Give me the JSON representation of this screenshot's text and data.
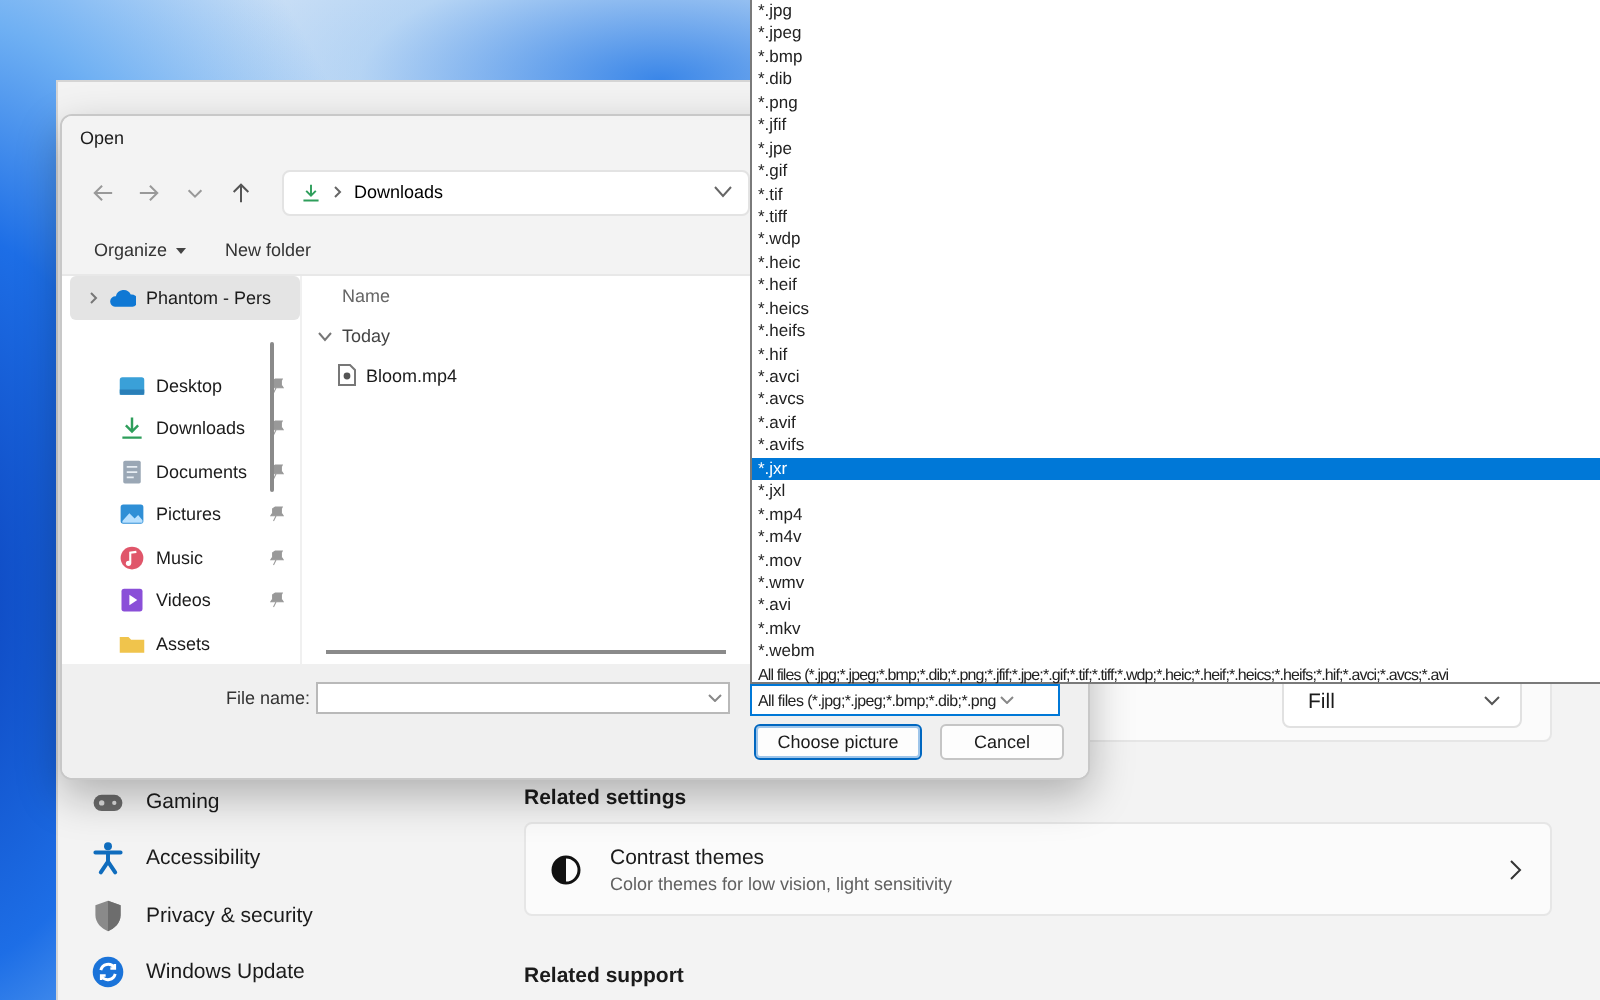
{
  "settings_window": {
    "sidebar_items": [
      {
        "label": "Gaming",
        "kind": "gaming"
      },
      {
        "label": "Accessibility",
        "kind": "accessibility"
      },
      {
        "label": "Privacy & security",
        "kind": "privacy"
      },
      {
        "label": "Windows Update",
        "kind": "update"
      }
    ],
    "fit_dropdown": {
      "value": "Fill"
    },
    "related_settings_heading": "Related settings",
    "contrast_card": {
      "title": "Contrast themes",
      "subtitle": "Color themes for low vision, light sensitivity"
    },
    "related_support_heading": "Related support"
  },
  "dialog": {
    "title": "Open",
    "address": {
      "location": "Downloads"
    },
    "toolbar": [
      {
        "label": "Organize",
        "kind": "menu"
      },
      {
        "label": "New folder",
        "kind": "plain"
      }
    ],
    "nav_items": [
      {
        "label": "Phantom - Pers",
        "kind": "cloud",
        "selected": true,
        "pinned": false
      },
      {
        "label": "Desktop",
        "kind": "desktop",
        "selected": false,
        "pinned": true
      },
      {
        "label": "Downloads",
        "kind": "downloads",
        "selected": false,
        "pinned": true
      },
      {
        "label": "Documents",
        "kind": "documents",
        "selected": false,
        "pinned": true
      },
      {
        "label": "Pictures",
        "kind": "pictures",
        "selected": false,
        "pinned": true
      },
      {
        "label": "Music",
        "kind": "music",
        "selected": false,
        "pinned": true
      },
      {
        "label": "Videos",
        "kind": "videos",
        "selected": false,
        "pinned": true
      },
      {
        "label": "Assets",
        "kind": "folder",
        "selected": false,
        "pinned": false
      }
    ],
    "column_header": "Name",
    "group": {
      "label": "Today",
      "expanded": true
    },
    "files": [
      {
        "name": "Bloom.mp4"
      }
    ],
    "file_name": {
      "label": "File name:"
    },
    "file_type": {
      "value": "All files (*.jpg;*.jpeg;*.bmp;*.dib;*.png"
    },
    "buttons": [
      {
        "label": "Choose picture",
        "kind": "primary"
      },
      {
        "label": "Cancel",
        "kind": "secondary"
      }
    ]
  },
  "file_type_list": {
    "items": [
      {
        "label": "*.jpg",
        "selected": false
      },
      {
        "label": "*.jpeg",
        "selected": false
      },
      {
        "label": "*.bmp",
        "selected": false
      },
      {
        "label": "*.dib",
        "selected": false
      },
      {
        "label": "*.png",
        "selected": false
      },
      {
        "label": "*.jfif",
        "selected": false
      },
      {
        "label": "*.jpe",
        "selected": false
      },
      {
        "label": "*.gif",
        "selected": false
      },
      {
        "label": "*.tif",
        "selected": false
      },
      {
        "label": "*.tiff",
        "selected": false
      },
      {
        "label": "*.wdp",
        "selected": false
      },
      {
        "label": "*.heic",
        "selected": false
      },
      {
        "label": "*.heif",
        "selected": false
      },
      {
        "label": "*.heics",
        "selected": false
      },
      {
        "label": "*.heifs",
        "selected": false
      },
      {
        "label": "*.hif",
        "selected": false
      },
      {
        "label": "*.avci",
        "selected": false
      },
      {
        "label": "*.avcs",
        "selected": false
      },
      {
        "label": "*.avif",
        "selected": false
      },
      {
        "label": "*.avifs",
        "selected": false
      },
      {
        "label": "*.jxr",
        "selected": true
      },
      {
        "label": "*.jxl",
        "selected": false
      },
      {
        "label": "*.mp4",
        "selected": false
      },
      {
        "label": "*.m4v",
        "selected": false
      },
      {
        "label": "*.mov",
        "selected": false
      },
      {
        "label": "*.wmv",
        "selected": false
      },
      {
        "label": "*.avi",
        "selected": false
      },
      {
        "label": "*.mkv",
        "selected": false
      },
      {
        "label": "*.webm",
        "selected": false
      },
      {
        "label": "All files (*.jpg;*.jpeg;*.bmp;*.dib;*.png;*.jfif;*.jpe;*.gif;*.tif;*.tiff;*.wdp;*.heic;*.heif;*.heics;*.heifs;*.hif;*.avci;*.avcs;*.avi",
        "selected": false
      }
    ]
  }
}
